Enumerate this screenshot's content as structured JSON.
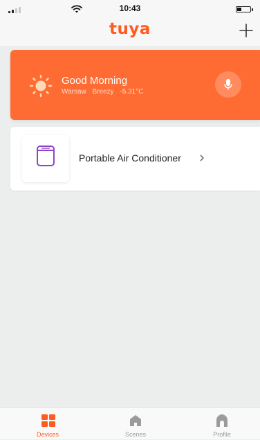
{
  "status_bar": {
    "time": "10:43"
  },
  "header": {
    "logo_text": "tuya",
    "add_icon": "plus-icon"
  },
  "weather": {
    "greeting": "Good Morning",
    "city": "Warsaw",
    "condition": "Breezy",
    "temperature": "-5.31°C",
    "weather_icon": "sun-icon",
    "voice_icon": "microphone-icon"
  },
  "devices": [
    {
      "name": "Portable Air Conditioner",
      "icon": "air-conditioner-icon"
    }
  ],
  "tabs": [
    {
      "label": "Devices",
      "icon": "devices-grid-icon",
      "active": true
    },
    {
      "label": "Scenes",
      "icon": "home-icon",
      "active": false
    },
    {
      "label": "Profile",
      "icon": "profile-icon",
      "active": false
    }
  ],
  "colors": {
    "accent": "#ff5a1f",
    "weather_card": "#ff6c33",
    "background": "#eceded",
    "tab_inactive": "#9b9b9b"
  }
}
